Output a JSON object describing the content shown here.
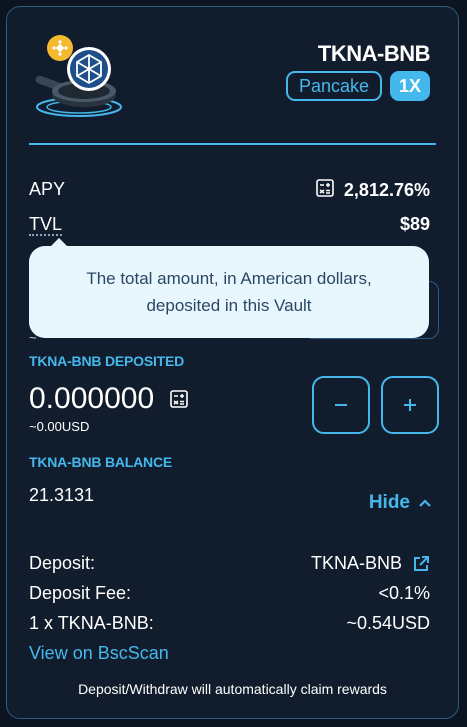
{
  "header": {
    "pair_title": "TKNA-BNB",
    "exchange_tag": "Pancake",
    "multiplier_tag": "1X"
  },
  "stats": {
    "apy_label": "APY",
    "apy_value": "2,812.76%",
    "tvl_label": "TVL",
    "tvl_value": "$89"
  },
  "tooltip": {
    "line1": "The total amount, in American dollars,",
    "line2": "deposited in this Vault",
    "partial_hidden_text": "~"
  },
  "deposited": {
    "label": "TKNA-BNB DEPOSITED",
    "amount": "0.000000",
    "usd": "~0.00USD"
  },
  "balance": {
    "label": "TKNA-BNB BALANCE",
    "amount": "21.3131"
  },
  "controls": {
    "hide_label": "Hide"
  },
  "details": {
    "deposit_label": "Deposit:",
    "deposit_value": "TKNA-BNB",
    "fee_label": "Deposit Fee:",
    "fee_value": "<0.1%",
    "price_label": "1 x TKNA-BNB:",
    "price_value": "~0.54USD",
    "bscscan_link": "View on BscScan"
  },
  "footer": {
    "note": "Deposit/Withdraw will automatically claim rewards"
  },
  "colors": {
    "accent": "#44b8ec",
    "card_bg": "#111d2c",
    "page_bg": "#0b1420",
    "tooltip_bg": "#e8f6fe",
    "bnb_yellow": "#f3ba2f"
  },
  "icons": {
    "logo": "pancake-pan-logo-icon",
    "apy": "calculator-icon",
    "deposit_calc": "calculator-icon",
    "minus": "minus-icon",
    "plus": "plus-icon",
    "hide": "chevron-up-icon",
    "external": "external-link-icon"
  }
}
